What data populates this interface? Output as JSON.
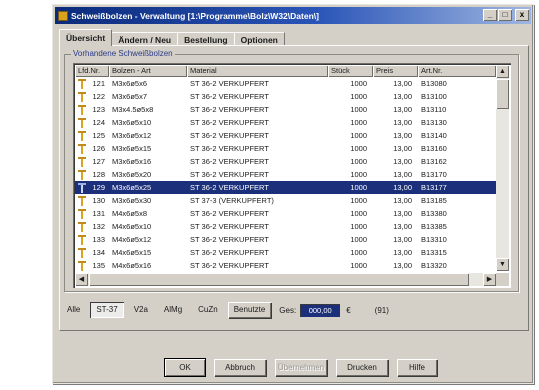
{
  "window": {
    "title": "Schweißbolzen - Verwaltung [1:\\Programme\\Bolz\\W32\\Daten\\]",
    "controls": [
      "_",
      "□",
      "x"
    ]
  },
  "tabs": [
    {
      "label": "Übersicht",
      "active": true
    },
    {
      "label": "Ändern / Neu",
      "active": false
    },
    {
      "label": "Bestellung",
      "active": false
    },
    {
      "label": "Optionen",
      "active": false
    }
  ],
  "group": {
    "label": "Vorhandene Schweißbolzen"
  },
  "list": {
    "columns": [
      "Lfd.Nr.",
      "Bolzen - Art",
      "Material",
      "Stück",
      "Preis",
      "Art.Nr."
    ],
    "rows": [
      {
        "nr": "121",
        "bolzen": "M3x6ø5x6",
        "material": "ST 36-2 VERKUPFERT",
        "stueck": "1000",
        "preis": "13,00",
        "artnr": "B13080",
        "selected": false
      },
      {
        "nr": "122",
        "bolzen": "M3x6ø5x7",
        "material": "ST 36-2 VERKUPFERT",
        "stueck": "1000",
        "preis": "13,00",
        "artnr": "B13100",
        "selected": false
      },
      {
        "nr": "123",
        "bolzen": "M3x4.5ø5x8",
        "material": "ST 36-2 VERKUPFERT",
        "stueck": "1000",
        "preis": "13,00",
        "artnr": "B13110",
        "selected": false
      },
      {
        "nr": "124",
        "bolzen": "M3x6ø5x10",
        "material": "ST 36-2 VERKUPFERT",
        "stueck": "1000",
        "preis": "13,00",
        "artnr": "B13130",
        "selected": false
      },
      {
        "nr": "125",
        "bolzen": "M3x6ø5x12",
        "material": "ST 36-2 VERKUPFERT",
        "stueck": "1000",
        "preis": "13,00",
        "artnr": "B13140",
        "selected": false
      },
      {
        "nr": "126",
        "bolzen": "M3x6ø5x15",
        "material": "ST 36-2 VERKUPFERT",
        "stueck": "1000",
        "preis": "13,00",
        "artnr": "B13160",
        "selected": false
      },
      {
        "nr": "127",
        "bolzen": "M3x6ø5x16",
        "material": "ST 36-2 VERKUPFERT",
        "stueck": "1000",
        "preis": "13,00",
        "artnr": "B13162",
        "selected": false
      },
      {
        "nr": "128",
        "bolzen": "M3x6ø5x20",
        "material": "ST 36-2 VERKUPFERT",
        "stueck": "1000",
        "preis": "13,00",
        "artnr": "B13170",
        "selected": false
      },
      {
        "nr": "129",
        "bolzen": "M3x6ø5x25",
        "material": "ST 36-2 VERKUPFERT",
        "stueck": "1000",
        "preis": "13,00",
        "artnr": "B13177",
        "selected": true
      },
      {
        "nr": "130",
        "bolzen": "M3x6ø5x30",
        "material": "ST 37-3 (VERKUPFERT)",
        "stueck": "1000",
        "preis": "13,00",
        "artnr": "B13185",
        "selected": false
      },
      {
        "nr": "131",
        "bolzen": "M4x6ø5x8",
        "material": "ST 36-2 VERKUPFERT",
        "stueck": "1000",
        "preis": "13,00",
        "artnr": "B13380",
        "selected": false
      },
      {
        "nr": "132",
        "bolzen": "M4x6ø5x10",
        "material": "ST 36-2 VERKUPFERT",
        "stueck": "1000",
        "preis": "13,00",
        "artnr": "B13385",
        "selected": false
      },
      {
        "nr": "133",
        "bolzen": "M4x6ø5x12",
        "material": "ST 36-2 VERKUPFERT",
        "stueck": "1000",
        "preis": "13,00",
        "artnr": "B13310",
        "selected": false
      },
      {
        "nr": "134",
        "bolzen": "M4x6ø5x15",
        "material": "ST 36-2 VERKUPFERT",
        "stueck": "1000",
        "preis": "13,00",
        "artnr": "B13315",
        "selected": false
      },
      {
        "nr": "135",
        "bolzen": "M4x6ø5x16",
        "material": "ST 36-2 VERKUPFERT",
        "stueck": "1000",
        "preis": "13,00",
        "artnr": "B13320",
        "selected": false
      }
    ]
  },
  "filters": [
    {
      "label": "Alle",
      "pressed": false,
      "raised": false
    },
    {
      "label": "ST-37",
      "pressed": true,
      "raised": false
    },
    {
      "label": "V2a",
      "pressed": false,
      "raised": false
    },
    {
      "label": "AlMg",
      "pressed": false,
      "raised": false
    },
    {
      "label": "CuZn",
      "pressed": false,
      "raised": false
    },
    {
      "label": "Benutzte",
      "pressed": false,
      "raised": true
    }
  ],
  "summary": {
    "ges_label": "Ges:",
    "ges_value": "000,00",
    "currency": "€",
    "count": "(91)"
  },
  "buttons": [
    {
      "label": "OK",
      "disabled": false,
      "default": true
    },
    {
      "label": "Abbruch",
      "disabled": false,
      "default": false
    },
    {
      "label": "Übernehmen",
      "disabled": true,
      "default": false
    },
    {
      "label": "Drucken",
      "disabled": false,
      "default": false
    },
    {
      "label": "Hilfe",
      "disabled": false,
      "default": false
    }
  ],
  "colors": {
    "selection": "#1b2f7a",
    "title_start": "#0b2a7a",
    "title_end": "#9fb6e0",
    "face": "#d4d0c8"
  }
}
